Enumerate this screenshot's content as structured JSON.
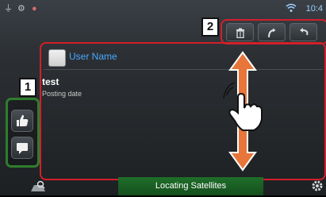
{
  "status_bar": {
    "time": "10:4"
  },
  "callouts": {
    "left": "1",
    "top": "2"
  },
  "post": {
    "user_name": "User Name",
    "text": "test",
    "posting_date": "Posting date"
  },
  "toolbar": {
    "delete_icon": "trash-icon",
    "reply_icon": "reply-icon",
    "back_icon": "back-arrow-icon"
  },
  "side_buttons": [
    {
      "icon": "thumbs-up-icon"
    },
    {
      "icon": "comment-icon"
    }
  ],
  "bottom_bar": {
    "status": "Locating Satellites"
  },
  "colors": {
    "accent_red": "#d21f2b",
    "group_green": "#2e7d2e",
    "username_blue": "#4aa8ff",
    "status_green": "#1f6f2a"
  }
}
